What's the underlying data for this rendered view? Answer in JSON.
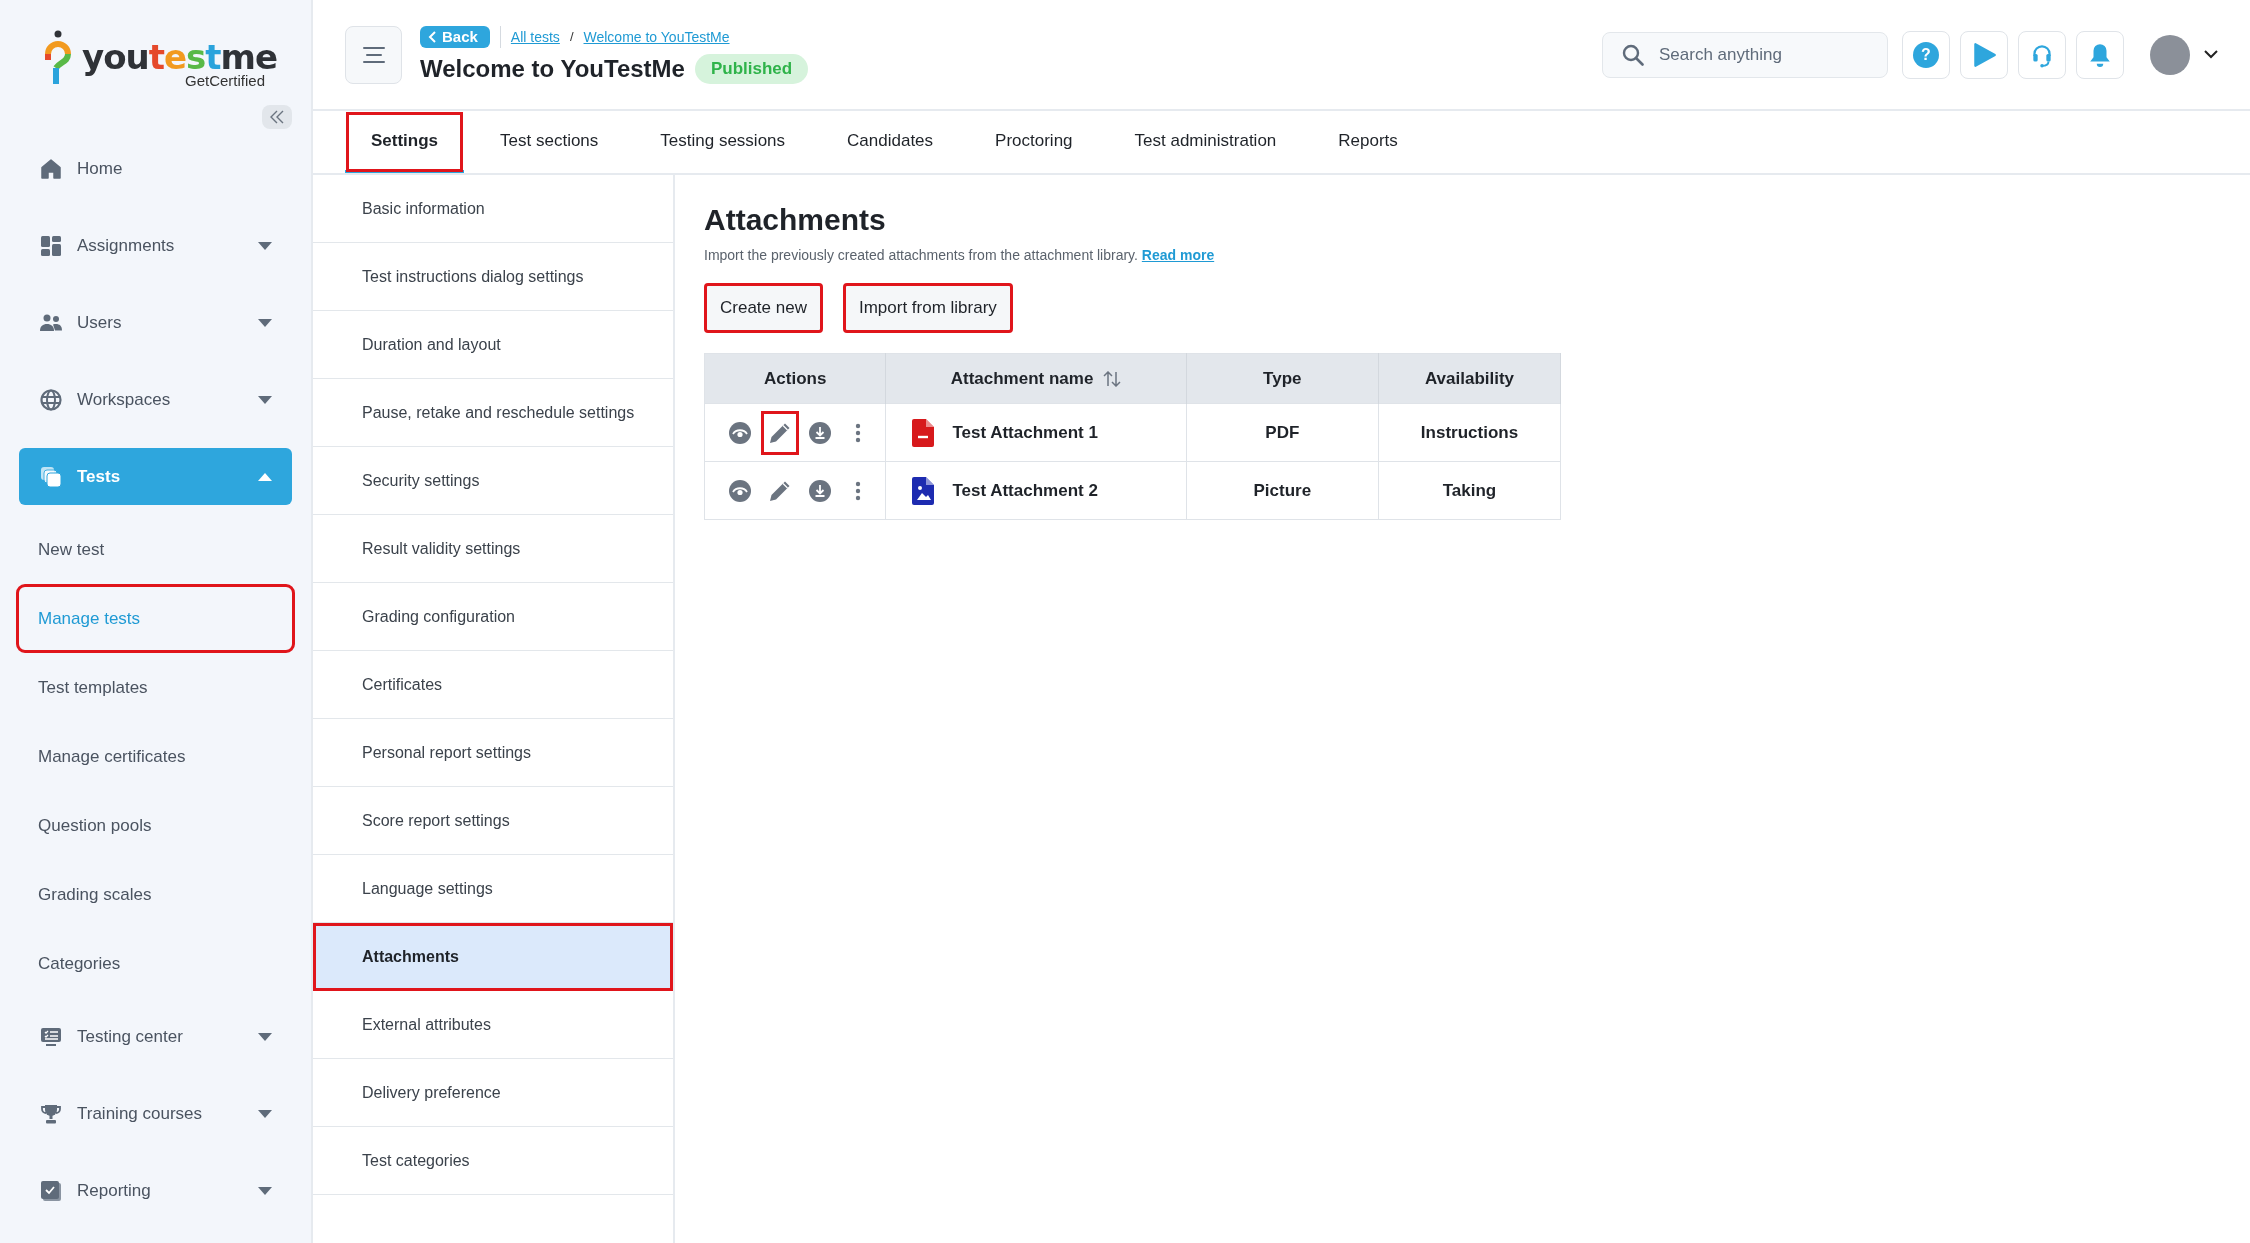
{
  "logo": {
    "parts": [
      {
        "text": "you",
        "color": "#2f3237"
      },
      {
        "text": "t",
        "color": "#e5492b"
      },
      {
        "text": "e",
        "color": "#f29a1f"
      },
      {
        "text": "s",
        "color": "#59b947"
      },
      {
        "text": "t",
        "color": "#2aa3dc"
      },
      {
        "text": "me",
        "color": "#2f3237"
      }
    ],
    "tagline": "GetCertified"
  },
  "sidebar": {
    "items": [
      {
        "kind": "top",
        "label": "Home",
        "selected": false,
        "highlighted": false
      },
      {
        "kind": "group",
        "label": "Assignments",
        "selected": false,
        "expanded": false,
        "highlighted": false
      },
      {
        "kind": "group",
        "label": "Users",
        "selected": false,
        "expanded": false,
        "highlighted": false
      },
      {
        "kind": "group",
        "label": "Workspaces",
        "selected": false,
        "expanded": false,
        "highlighted": false
      },
      {
        "kind": "group",
        "label": "Tests",
        "selected": true,
        "expanded": true,
        "highlighted": false
      },
      {
        "kind": "sub",
        "label": "New test",
        "selected": false,
        "highlighted": false
      },
      {
        "kind": "sub",
        "label": "Manage tests",
        "selected": true,
        "highlighted": true
      },
      {
        "kind": "sub",
        "label": "Test templates",
        "selected": false,
        "highlighted": false
      },
      {
        "kind": "sub",
        "label": "Manage certificates",
        "selected": false,
        "highlighted": false
      },
      {
        "kind": "sub",
        "label": "Question pools",
        "selected": false,
        "highlighted": false
      },
      {
        "kind": "sub",
        "label": "Grading scales",
        "selected": false,
        "highlighted": false
      },
      {
        "kind": "sub",
        "label": "Categories",
        "selected": false,
        "highlighted": false
      },
      {
        "kind": "group",
        "label": "Testing center",
        "selected": false,
        "expanded": false,
        "highlighted": false
      },
      {
        "kind": "group",
        "label": "Training courses",
        "selected": false,
        "expanded": false,
        "highlighted": false
      },
      {
        "kind": "group",
        "label": "Reporting",
        "selected": false,
        "expanded": false,
        "highlighted": false
      }
    ]
  },
  "header": {
    "back": "Back",
    "breadcrumbs": [
      {
        "label": "All tests"
      },
      {
        "label": "Welcome to YouTestMe"
      }
    ],
    "separator": "/",
    "title": "Welcome to YouTestMe",
    "status": "Published",
    "help": "?",
    "search": {
      "placeholder": "Search anything"
    }
  },
  "tabs": [
    {
      "label": "Settings",
      "selected": true,
      "highlighted": true
    },
    {
      "label": "Test sections",
      "selected": false,
      "highlighted": false
    },
    {
      "label": "Testing sessions",
      "selected": false,
      "highlighted": false
    },
    {
      "label": "Candidates",
      "selected": false,
      "highlighted": false
    },
    {
      "label": "Proctoring",
      "selected": false,
      "highlighted": false
    },
    {
      "label": "Test administration",
      "selected": false,
      "highlighted": false
    },
    {
      "label": "Reports",
      "selected": false,
      "highlighted": false
    }
  ],
  "settings_menu": {
    "items": [
      {
        "label": "Basic information",
        "selected": false,
        "highlighted": false
      },
      {
        "label": "Test instructions dialog settings",
        "selected": false,
        "highlighted": false
      },
      {
        "label": "Duration and layout",
        "selected": false,
        "highlighted": false
      },
      {
        "label": "Pause, retake and reschedule settings",
        "selected": false,
        "highlighted": false
      },
      {
        "label": "Security settings",
        "selected": false,
        "highlighted": false
      },
      {
        "label": "Result validity settings",
        "selected": false,
        "highlighted": false
      },
      {
        "label": "Grading configuration",
        "selected": false,
        "highlighted": false
      },
      {
        "label": "Certificates",
        "selected": false,
        "highlighted": false
      },
      {
        "label": "Personal report settings",
        "selected": false,
        "highlighted": false
      },
      {
        "label": "Score report settings",
        "selected": false,
        "highlighted": false
      },
      {
        "label": "Language settings",
        "selected": false,
        "highlighted": false
      },
      {
        "label": "Attachments",
        "selected": true,
        "highlighted": true
      },
      {
        "label": "External attributes",
        "selected": false,
        "highlighted": false
      },
      {
        "label": "Delivery preference",
        "selected": false,
        "highlighted": false
      },
      {
        "label": "Test categories",
        "selected": false,
        "highlighted": false
      }
    ]
  },
  "attachments": {
    "title": "Attachments",
    "description": "Import the previously created attachments from the attachment library.",
    "read_more": "Read more",
    "buttons": [
      {
        "label": "Create new",
        "highlighted": true
      },
      {
        "label": "Import from library",
        "highlighted": true
      }
    ],
    "table": {
      "columns": [
        {
          "label": "Actions",
          "sortable": false
        },
        {
          "label": "Attachment name",
          "sortable": true
        },
        {
          "label": "Type",
          "sortable": false
        },
        {
          "label": "Availability",
          "sortable": false
        }
      ],
      "rows": [
        {
          "kind": "pdf",
          "name": "Test Attachment 1",
          "type": "PDF",
          "availability": "Instructions",
          "edit_highlighted": true
        },
        {
          "kind": "picture",
          "name": "Test Attachment 2",
          "type": "Picture",
          "availability": "Taking",
          "edit_highlighted": false
        }
      ]
    }
  }
}
